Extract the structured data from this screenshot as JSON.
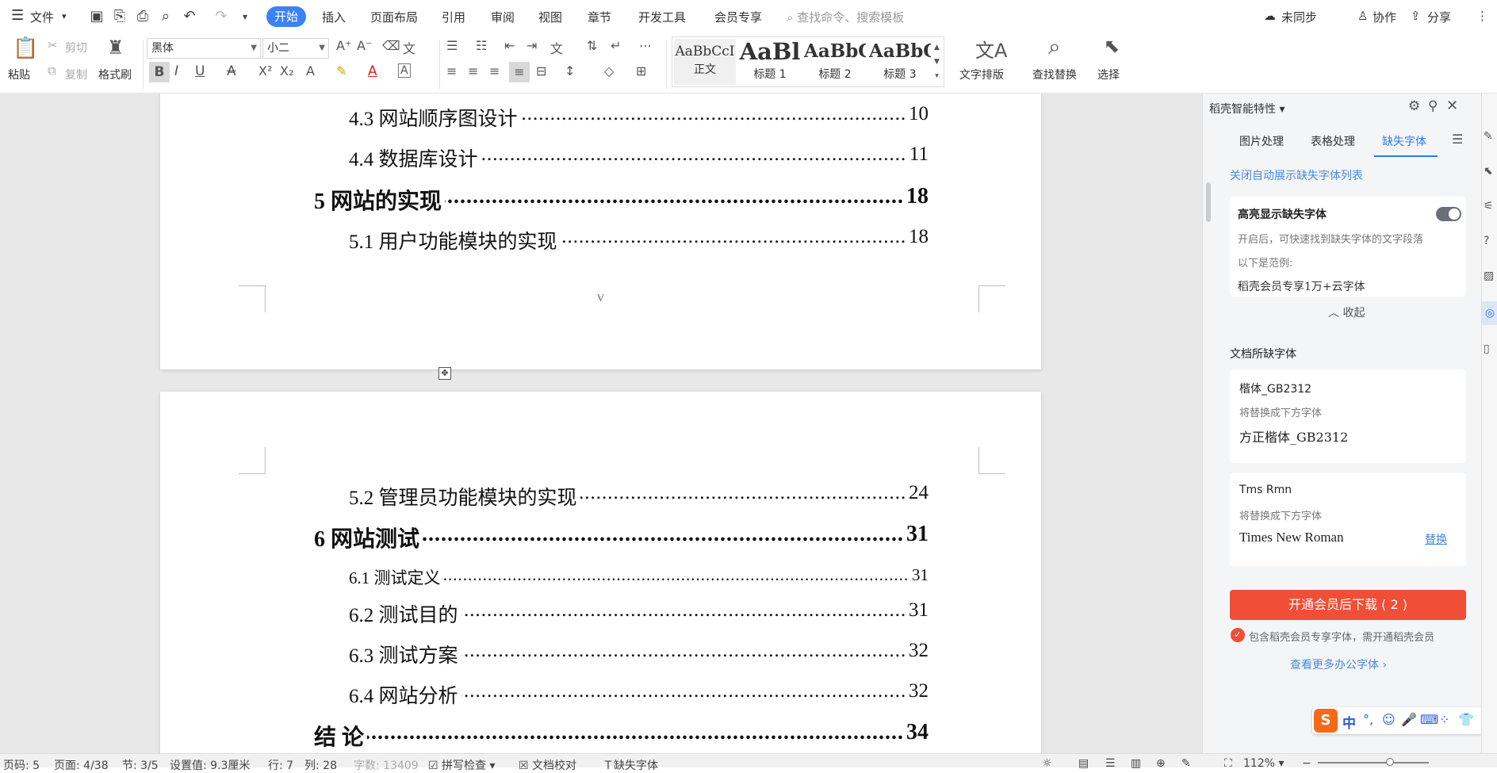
{
  "menubar": {
    "file_label": "文件",
    "tabs": [
      "开始",
      "插入",
      "页面布局",
      "引用",
      "审阅",
      "视图",
      "章节",
      "开发工具",
      "会员专享"
    ],
    "search_placeholder": "查找命令、搜索模板",
    "sync_label": "未同步",
    "collab_label": "协作",
    "share_label": "分享"
  },
  "ribbon": {
    "paste_label": "粘贴",
    "cut_label": "剪切",
    "copy_label": "复制",
    "format_painter_label": "格式刷",
    "font_name": "黑体",
    "font_size": "小二",
    "styles": [
      {
        "preview": "AaBbCcI",
        "label": "正文"
      },
      {
        "preview": "AaBl",
        "label": "标题 1"
      },
      {
        "preview": "AaBbC",
        "label": "标题 2"
      },
      {
        "preview": "AaBbC",
        "label": "标题 3"
      }
    ],
    "text_layout_label": "文字排版",
    "find_replace_label": "查找替换",
    "select_label": "选择"
  },
  "document": {
    "page1_entries": [
      {
        "level": 2,
        "title": "4.3  网站顺序图设计",
        "page": "10"
      },
      {
        "level": 2,
        "title": "4.4  数据库设计",
        "page": "11"
      },
      {
        "level": 1,
        "title": "5   网站的实现",
        "page": "18"
      },
      {
        "level": 2,
        "title": "5.1  用户功能模块的实现",
        "page": "18"
      }
    ],
    "page1_number": "V",
    "page2_entries": [
      {
        "level": 2,
        "title": "5.2  管理员功能模块的实现",
        "page": "24"
      },
      {
        "level": 1,
        "title": "6   网站测试",
        "page": "31"
      },
      {
        "level": 3,
        "title": "6.1  测试定义",
        "page": "31"
      },
      {
        "level": 2,
        "title": "6.2  测试目的",
        "page": "31"
      },
      {
        "level": 2,
        "title": "6.3  测试方案",
        "page": "32"
      },
      {
        "level": 2,
        "title": "6.4  网站分析",
        "page": "32"
      },
      {
        "level": 1,
        "title": "结    论",
        "page": "34"
      }
    ]
  },
  "panel": {
    "header": "稻壳智能特性",
    "tabs": [
      "图片处理",
      "表格处理",
      "缺失字体"
    ],
    "active_tab": "缺失字体",
    "close_auto_show_link": "关闭自动展示缺失字体列表",
    "highlight": {
      "title": "高亮显示缺失字体",
      "desc": "开启后，可快速找到缺失字体的文字段落",
      "example_label": "以下是范例:",
      "example_text": "稻壳会员专享1万+云字体",
      "collapse_label": "收起"
    },
    "missing_title": "文档所缺字体",
    "fonts": [
      {
        "name": "楷体_GB2312",
        "replace_hint": "将替换成下方字体",
        "replacement": "方正楷体_GB2312",
        "action": ""
      },
      {
        "name": "Tms Rmn",
        "replace_hint": "将替换成下方字体",
        "replacement": "Times New Roman",
        "action": "替换"
      }
    ],
    "download_button": "开通会员后下载 ( 2 )",
    "member_note": "包含稻壳会员专享字体，需开通稻壳会员",
    "more_fonts_link": "查看更多办公字体",
    "ime_label": "中"
  },
  "statusbar": {
    "page_code": "页码: 5",
    "page_count": "页面: 4/38",
    "section": "节: 3/5",
    "setting": "设置值: 9.3厘米",
    "row": "行: 7",
    "col": "列: 28",
    "word_count": "字数: 13409",
    "spell_check": "拼写检查",
    "doc_check": "文档校对",
    "missing_font": "缺失字体",
    "zoom": "112%"
  }
}
